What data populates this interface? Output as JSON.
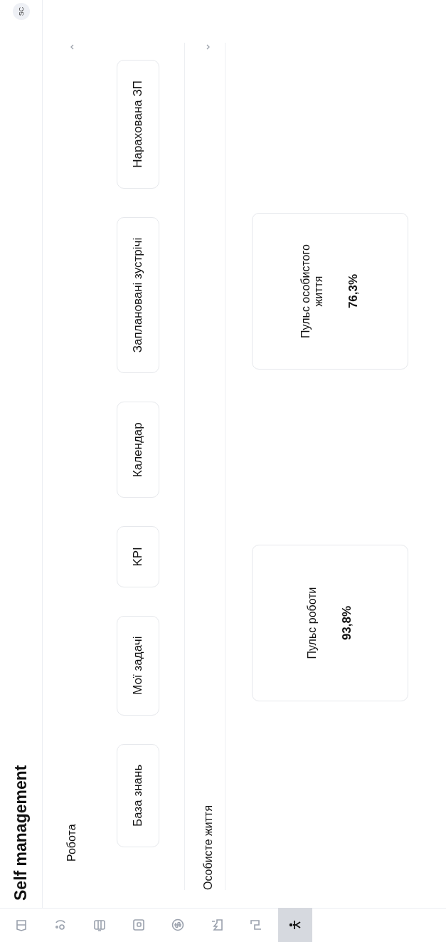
{
  "nav": [
    {
      "selected": false
    },
    {
      "selected": false
    },
    {
      "selected": false
    },
    {
      "selected": false
    },
    {
      "selected": false
    },
    {
      "selected": false
    },
    {
      "selected": false
    },
    {
      "selected": true
    }
  ],
  "header": {
    "title": "Self management",
    "avatar": "SC"
  },
  "sections": [
    {
      "title": "Робота",
      "expanded": true,
      "buttons": [
        "База знань",
        "Мої задачі",
        "KPI",
        "Календар",
        "Заплановані зустрічі",
        "Нарахована ЗП"
      ]
    },
    {
      "title": "Особисте життя",
      "expanded": false
    }
  ],
  "cards": [
    {
      "label": "Пульс роботи",
      "value": "93,8%"
    },
    {
      "label": "Пульс особистого життя",
      "value": "76,3%"
    }
  ]
}
